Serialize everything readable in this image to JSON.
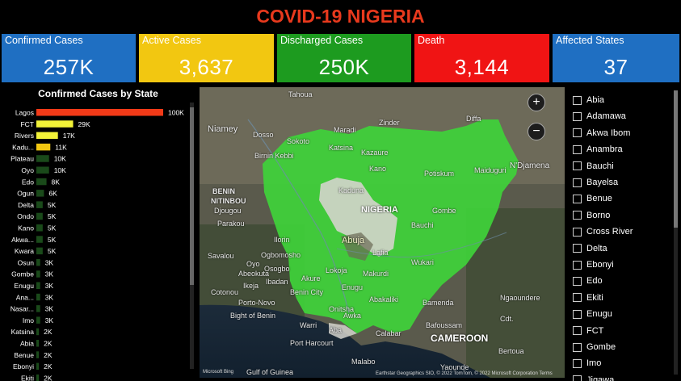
{
  "title": "COVID-19 NIGERIA",
  "cards": [
    {
      "label": "Confirmed Cases",
      "value": "257K",
      "color": "#1f6fc2"
    },
    {
      "label": "Active Cases",
      "value": "3,637",
      "color": "#f2c711"
    },
    {
      "label": "Discharged Cases",
      "value": "250K",
      "color": "#1d9b1f"
    },
    {
      "label": "Death",
      "value": "3,144",
      "color": "#f01414"
    },
    {
      "label": "Affected States",
      "value": "37",
      "color": "#1f6fc2"
    }
  ],
  "chart_data": {
    "type": "bar",
    "orientation": "horizontal",
    "title": "Confirmed Cases by State",
    "categories": [
      "Lagos",
      "FCT",
      "Rivers",
      "Kadu...",
      "Plateau",
      "Oyo",
      "Edo",
      "Ogun",
      "Delta",
      "Ondo",
      "Kano",
      "Akwa...",
      "Kwara",
      "Osun",
      "Gombe",
      "Enugu",
      "Ana...",
      "Nasar...",
      "Imo",
      "Katsina",
      "Abia",
      "Benue",
      "Ebonyi",
      "Ekiti"
    ],
    "values": [
      100,
      29,
      17,
      11,
      10,
      10,
      8,
      6,
      5,
      5,
      5,
      5,
      5,
      3,
      3,
      3,
      3,
      3,
      3,
      2,
      2,
      2,
      2,
      2
    ],
    "data_labels": [
      "100K",
      "29K",
      "17K",
      "11K",
      "10K",
      "10K",
      "8K",
      "6K",
      "5K",
      "5K",
      "5K",
      "5K",
      "5K",
      "3K",
      "3K",
      "3K",
      "3K",
      "3K",
      "3K",
      "2K",
      "2K",
      "2K",
      "2K",
      "2K"
    ],
    "colors": [
      "#f23a18",
      "#f2f238",
      "#f2f238",
      "#f2c711",
      "#1a4a1a",
      "#1a4a1a",
      "#1a4a1a",
      "#1a4a1a",
      "#1a4a1a",
      "#1a4a1a",
      "#1a4a1a",
      "#1a4a1a",
      "#1a4a1a",
      "#1a4a1a",
      "#1a4a1a",
      "#1a4a1a",
      "#1a4a1a",
      "#1a4a1a",
      "#1a4a1a",
      "#1a4a1a",
      "#1a4a1a",
      "#1a4a1a",
      "#1a4a1a",
      "#1a4a1a"
    ],
    "units": "K",
    "xlim": [
      0,
      100
    ]
  },
  "map": {
    "country_label": "NIGERIA",
    "labels": [
      "Tahoua",
      "Niamey",
      "Dosso",
      "Maradi",
      "Zinder",
      "Diffa",
      "Sokoto",
      "Katsina",
      "Birnin Kebbi",
      "Kazaure",
      "Kano",
      "Potiskum",
      "Maiduguri",
      "N'Djamena",
      "Kaduna",
      "BENIN",
      "NITINBOU",
      "Djougou",
      "Bauchi",
      "Gombe",
      "Abuja",
      "Ilorin",
      "Lafia",
      "Ogbomosho",
      "Oyo",
      "Osogbo",
      "Lokoja",
      "Makurdi",
      "Wukari",
      "Ibadan",
      "Akure",
      "Abeokuta",
      "Ikeja",
      "Benin City",
      "Enugu",
      "Porto-Novo",
      "Onitsha",
      "Awka",
      "Abakaliki",
      "Bamenda",
      "Bight of Benin",
      "Warri",
      "Aba",
      "Calabar",
      "Bafoussam",
      "Port Harcourt",
      "CAMEROON",
      "Yaounde",
      "Malabo",
      "Gulf of Guinea",
      "Savalou",
      "Cotonou",
      "Parakou",
      "Cdt.",
      "Bertoua",
      "Ngaoundere"
    ],
    "footer": "Earthstar Geographics SIO, © 2022 TomTom, © 2022 Microsoft Corporation  Terms",
    "logo": "Microsoft Bing",
    "zoom_in": "+",
    "zoom_out": "−"
  },
  "slicer": {
    "items": [
      "Abia",
      "Adamawa",
      "Akwa Ibom",
      "Anambra",
      "Bauchi",
      "Bayelsa",
      "Benue",
      "Borno",
      "Cross River",
      "Delta",
      "Ebonyi",
      "Edo",
      "Ekiti",
      "Enugu",
      "FCT",
      "Gombe",
      "Imo",
      "Jigawa"
    ]
  }
}
